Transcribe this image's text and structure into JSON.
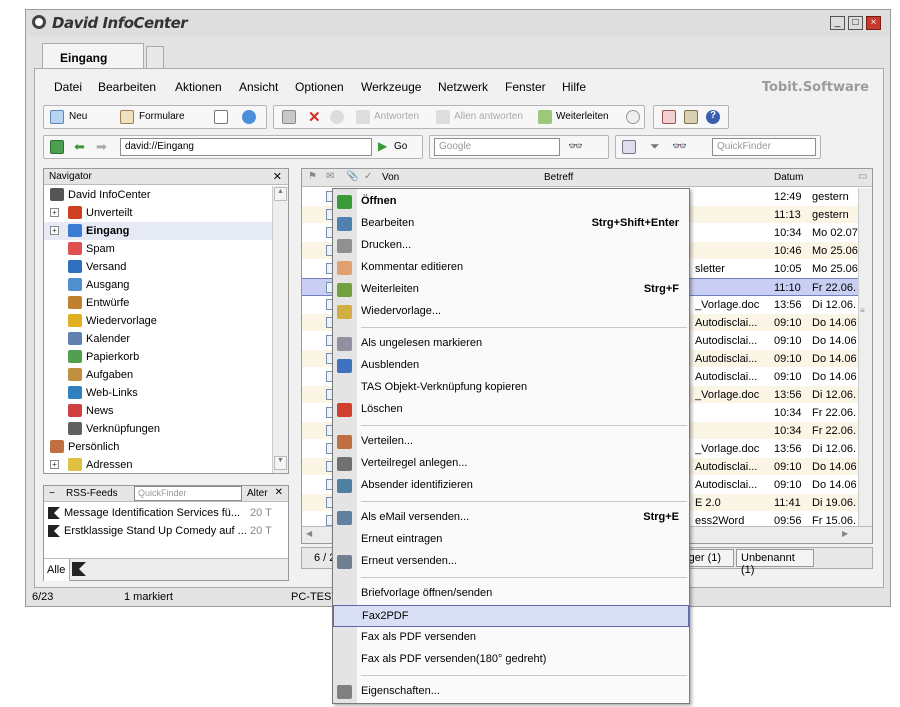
{
  "app": {
    "title": "David InfoCenter",
    "brand": "Tobit.Software"
  },
  "window_buttons": [
    "_",
    "□",
    "×"
  ],
  "tabs": [
    {
      "label": "Eingang",
      "active": true
    },
    {
      "label": "",
      "active": false
    }
  ],
  "menubar": [
    "Datei",
    "Bearbeiten",
    "Aktionen",
    "Ansicht",
    "Optionen",
    "Werkzeuge",
    "Netzwerk",
    "Fenster",
    "Hilfe"
  ],
  "toolbar": {
    "neu": "Neu",
    "formulare": "Formulare",
    "antworten": "Antworten",
    "allen_antworten": "Allen antworten",
    "weiterleiten": "Weiterleiten"
  },
  "address": {
    "value": "david://Eingang",
    "go": "Go",
    "search_placeholder": "Google",
    "quickfinder_placeholder": "QuickFinder"
  },
  "navigator": {
    "title": "Navigator",
    "items": [
      {
        "label": "David InfoCenter",
        "indent": 0,
        "bold": false,
        "expander": "",
        "icon": "david-logo-icon",
        "color": "#555"
      },
      {
        "label": "Unverteilt",
        "indent": 1,
        "bold": false,
        "expander": "+",
        "icon": "unassigned-icon",
        "color": "#d04020"
      },
      {
        "label": "Eingang",
        "indent": 1,
        "bold": true,
        "expander": "+",
        "icon": "inbox-icon",
        "color": "#3a7bd5"
      },
      {
        "label": "Spam",
        "indent": 1,
        "bold": false,
        "expander": "",
        "icon": "spam-icon",
        "color": "#e05050"
      },
      {
        "label": "Versand",
        "indent": 1,
        "bold": false,
        "expander": "",
        "icon": "outbox-icon",
        "color": "#2f6fc0"
      },
      {
        "label": "Ausgang",
        "indent": 1,
        "bold": false,
        "expander": "",
        "icon": "sent-icon",
        "color": "#5090d0"
      },
      {
        "label": "Entwürfe",
        "indent": 1,
        "bold": false,
        "expander": "",
        "icon": "drafts-icon",
        "color": "#c08030"
      },
      {
        "label": "Wiedervorlage",
        "indent": 1,
        "bold": false,
        "expander": "",
        "icon": "followup-icon",
        "color": "#e0b020"
      },
      {
        "label": "Kalender",
        "indent": 1,
        "bold": false,
        "expander": "",
        "icon": "calendar-icon",
        "color": "#6080b0"
      },
      {
        "label": "Papierkorb",
        "indent": 1,
        "bold": false,
        "expander": "",
        "icon": "trash-icon",
        "color": "#50a050"
      },
      {
        "label": "Aufgaben",
        "indent": 1,
        "bold": false,
        "expander": "",
        "icon": "tasks-icon",
        "color": "#c09040"
      },
      {
        "label": "Web-Links",
        "indent": 1,
        "bold": false,
        "expander": "",
        "icon": "weblinks-icon",
        "color": "#3080c0"
      },
      {
        "label": "News",
        "indent": 1,
        "bold": false,
        "expander": "",
        "icon": "news-icon",
        "color": "#d04040"
      },
      {
        "label": "Verknüpfungen",
        "indent": 1,
        "bold": false,
        "expander": "",
        "icon": "shortcuts-icon",
        "color": "#606060"
      },
      {
        "label": "Persönlich",
        "indent": 0,
        "bold": false,
        "expander": "−",
        "icon": "personal-icon",
        "color": "#c07040"
      },
      {
        "label": "Adressen",
        "indent": 1,
        "bold": false,
        "expander": "+",
        "icon": "addresses-icon",
        "color": "#e0c040"
      }
    ]
  },
  "rss": {
    "title": "RSS-Feeds",
    "quickfinder": "QuickFinder",
    "alter": "Alter",
    "items": [
      {
        "label": "Message Identification Services fü...",
        "age": "20 T"
      },
      {
        "label": "Erstklassige Stand Up Comedy auf ...",
        "age": "20 T"
      }
    ],
    "tab_all": "Alle"
  },
  "list": {
    "headers": {
      "von": "Von",
      "betreff": "Betreff",
      "datum": "Datum"
    },
    "rows": [
      {
        "subject": "",
        "time": "12:49",
        "date": "gestern",
        "selected": false,
        "bg": "#ffffff"
      },
      {
        "subject": "",
        "time": "11:13",
        "date": "gestern",
        "selected": false,
        "bg": "#fbf5e6"
      },
      {
        "subject": "",
        "time": "10:34",
        "date": "Mo 02.07",
        "selected": false,
        "bg": "#ffffff"
      },
      {
        "subject": "",
        "time": "10:46",
        "date": "Mo 25.06",
        "selected": false,
        "bg": "#fbf5e6"
      },
      {
        "subject": "sletter",
        "time": "10:05",
        "date": "Mo 25.06",
        "selected": false,
        "bg": "#ffffff"
      },
      {
        "subject": "",
        "time": "11:10",
        "date": "Fr 22.06.",
        "selected": true,
        "bg": "#c9cff2"
      },
      {
        "subject": "_Vorlage.doc",
        "time": "13:56",
        "date": "Di 12.06.",
        "selected": false,
        "bg": "#ffffff"
      },
      {
        "subject": "Autodisclai...",
        "time": "09:10",
        "date": "Do 14.06",
        "selected": false,
        "bg": "#fbf5e6"
      },
      {
        "subject": "Autodisclai...",
        "time": "09:10",
        "date": "Do 14.06",
        "selected": false,
        "bg": "#ffffff"
      },
      {
        "subject": "Autodisclai...",
        "time": "09:10",
        "date": "Do 14.06",
        "selected": false,
        "bg": "#fbf5e6"
      },
      {
        "subject": "Autodisclai...",
        "time": "09:10",
        "date": "Do 14.06",
        "selected": false,
        "bg": "#ffffff"
      },
      {
        "subject": "_Vorlage.doc",
        "time": "13:56",
        "date": "Di 12.06.",
        "selected": false,
        "bg": "#fbf5e6"
      },
      {
        "subject": "",
        "time": "10:34",
        "date": "Fr 22.06.",
        "selected": false,
        "bg": "#ffffff"
      },
      {
        "subject": "",
        "time": "10:34",
        "date": "Fr 22.06.",
        "selected": false,
        "bg": "#fbf5e6"
      },
      {
        "subject": "_Vorlage.doc",
        "time": "13:56",
        "date": "Di 12.06.",
        "selected": false,
        "bg": "#ffffff"
      },
      {
        "subject": "Autodisclai...",
        "time": "09:10",
        "date": "Do 14.06",
        "selected": false,
        "bg": "#fbf5e6"
      },
      {
        "subject": "Autodisclai...",
        "time": "09:10",
        "date": "Do 14.06",
        "selected": false,
        "bg": "#ffffff"
      },
      {
        "subject": "E 2.0",
        "time": "11:41",
        "date": "Di 19.06.",
        "selected": false,
        "bg": "#fbf5e6"
      },
      {
        "subject": "ess2Word",
        "time": "09:56",
        "date": "Fr 15.06.",
        "selected": false,
        "bg": "#ffffff"
      }
    ],
    "footer_left": "6 / 2",
    "footer_tabs": [
      "rger (1)",
      "Unbenannt (1)"
    ]
  },
  "status": {
    "count": "6/23",
    "marked": "1 markiert",
    "host": "PC-TEST"
  },
  "context_menu": [
    {
      "type": "item",
      "label": "Öffnen",
      "shortcut": "",
      "bold": true,
      "icon": "open-icon",
      "color": "#3a9a3a",
      "highlight": false
    },
    {
      "type": "item",
      "label": "Bearbeiten",
      "shortcut": "Strg+Shift+Enter",
      "bold": false,
      "icon": "edit-icon",
      "color": "#5080b0",
      "highlight": false
    },
    {
      "type": "item",
      "label": "Drucken...",
      "shortcut": "",
      "bold": false,
      "icon": "print-icon",
      "color": "#909090",
      "highlight": false
    },
    {
      "type": "item",
      "label": "Kommentar editieren",
      "shortcut": "",
      "bold": false,
      "icon": "comment-icon",
      "color": "#e0a070",
      "highlight": false
    },
    {
      "type": "item",
      "label": "Weiterleiten",
      "shortcut": "Strg+F",
      "bold": false,
      "icon": "forward-icon",
      "color": "#70a040",
      "highlight": false
    },
    {
      "type": "item",
      "label": "Wiedervorlage...",
      "shortcut": "",
      "bold": false,
      "icon": "followup-icon",
      "color": "#d0b040",
      "highlight": false
    },
    {
      "type": "sep"
    },
    {
      "type": "item",
      "label": "Als ungelesen markieren",
      "shortcut": "",
      "bold": false,
      "icon": "unread-icon",
      "color": "#9090a0",
      "highlight": false
    },
    {
      "type": "item",
      "label": "Ausblenden",
      "shortcut": "",
      "bold": false,
      "icon": "hide-icon",
      "color": "#4070c0",
      "highlight": false
    },
    {
      "type": "item",
      "label": "TAS Objekt-Verknüpfung kopieren",
      "shortcut": "",
      "bold": false,
      "icon": "",
      "color": "",
      "highlight": false
    },
    {
      "type": "item",
      "label": "Löschen",
      "shortcut": "",
      "bold": false,
      "icon": "delete-icon",
      "color": "#d04030",
      "highlight": false
    },
    {
      "type": "sep"
    },
    {
      "type": "item",
      "label": "Verteilen...",
      "shortcut": "",
      "bold": false,
      "icon": "distribute-icon",
      "color": "#c07040",
      "highlight": false
    },
    {
      "type": "item",
      "label": "Verteilregel anlegen...",
      "shortcut": "",
      "bold": false,
      "icon": "rule-icon",
      "color": "#707070",
      "highlight": false
    },
    {
      "type": "item",
      "label": "Absender identifizieren",
      "shortcut": "",
      "bold": false,
      "icon": "identify-icon",
      "color": "#5080a0",
      "highlight": false
    },
    {
      "type": "sep"
    },
    {
      "type": "item",
      "label": "Als eMail versenden...",
      "shortcut": "Strg+E",
      "bold": false,
      "icon": "email-icon",
      "color": "#6080a0",
      "highlight": false
    },
    {
      "type": "item",
      "label": "Erneut eintragen",
      "shortcut": "",
      "bold": false,
      "icon": "",
      "color": "",
      "highlight": false
    },
    {
      "type": "item",
      "label": "Erneut versenden...",
      "shortcut": "",
      "bold": false,
      "icon": "resend-icon",
      "color": "#708090",
      "highlight": false
    },
    {
      "type": "sep"
    },
    {
      "type": "item",
      "label": "Briefvorlage öffnen/senden",
      "shortcut": "",
      "bold": false,
      "icon": "",
      "color": "",
      "highlight": false
    },
    {
      "type": "item",
      "label": "Fax2PDF",
      "shortcut": "",
      "bold": false,
      "icon": "",
      "color": "",
      "highlight": true
    },
    {
      "type": "item",
      "label": "Fax als PDF versenden",
      "shortcut": "",
      "bold": false,
      "icon": "",
      "color": "",
      "highlight": false
    },
    {
      "type": "item",
      "label": "Fax als PDF versenden(180° gedreht)",
      "shortcut": "",
      "bold": false,
      "icon": "",
      "color": "",
      "highlight": false
    },
    {
      "type": "sep"
    },
    {
      "type": "item",
      "label": "Eigenschaften...",
      "shortcut": "",
      "bold": false,
      "icon": "properties-icon",
      "color": "#808080",
      "highlight": false
    }
  ]
}
